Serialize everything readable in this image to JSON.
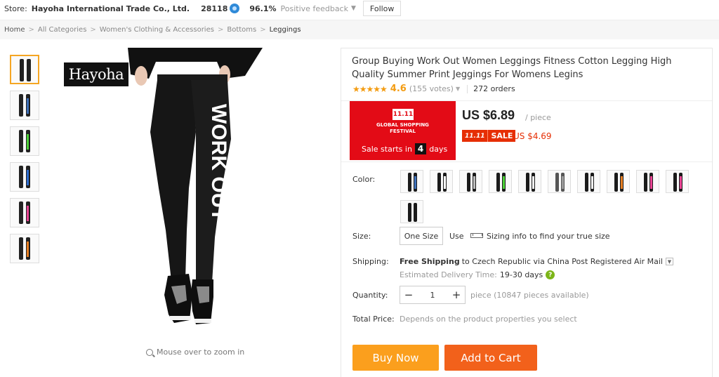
{
  "store": {
    "label": "Store:",
    "name": "Hayoha International Trade Co., Ltd.",
    "score": "28118",
    "positive_pct": "96.1%",
    "positive_label": "Positive feedback",
    "follow_label": "Follow"
  },
  "breadcrumb": [
    "Home",
    "All Categories",
    "Women's Clothing & Accessories",
    "Bottoms",
    "Leggings"
  ],
  "breadcrumb_sep": ">",
  "brand_logo": "Hayoha",
  "zoom_hint": "Mouse over to zoom in",
  "product": {
    "title": "Group Buying Work Out Women Leggings Fitness Cotton Legging High Quality Summer Print Jeggings For Womens Legins",
    "stars": "★★★★★",
    "rating": "4.6",
    "votes": "(155 votes)",
    "orders": "272 orders"
  },
  "promo": {
    "logo": "11.11",
    "line1": "GLOBAL SHOPPING",
    "line2": "FESTIVAL",
    "sale_prefix": "Sale starts in",
    "days_num": "4",
    "days_label": "days"
  },
  "price": {
    "main": "US $6.89",
    "unit": "/ piece",
    "badge_1111": "11.11",
    "badge_sale": "SALE",
    "sale_price": "US $4.69"
  },
  "labels": {
    "color": "Color:",
    "size": "Size:",
    "shipping": "Shipping:",
    "quantity": "Quantity:",
    "total": "Total Price:"
  },
  "color_accents": [
    "#3d6fb8",
    "#ffffff",
    "#bbbbbb",
    "#4cd137",
    "#eeeeee",
    "#999999",
    "#f0f0f0",
    "#e67e22",
    "#e84393",
    "#e84393",
    "#1a1a1a"
  ],
  "size": {
    "option": "One Size",
    "use": "Use",
    "info": "Sizing info",
    "tail": "to find your true size"
  },
  "shipping": {
    "free": "Free Shipping",
    "dest": "to Czech Republic via China Post Registered Air Mail",
    "est_label": "Estimated Delivery Time:",
    "est_days": "19-30 days",
    "help": "?"
  },
  "quantity": {
    "minus": "−",
    "value": "1",
    "plus": "+",
    "available": "piece (10847 pieces available)"
  },
  "total": {
    "value": "Depends on the product properties you select"
  },
  "actions": {
    "buy_now": "Buy Now",
    "add_to_cart": "Add to Cart"
  },
  "thumb_accents": [
    "#222222",
    "#3d6fb8",
    "#4cd137",
    "#2b6cd1",
    "#e84393",
    "#e67e22"
  ]
}
